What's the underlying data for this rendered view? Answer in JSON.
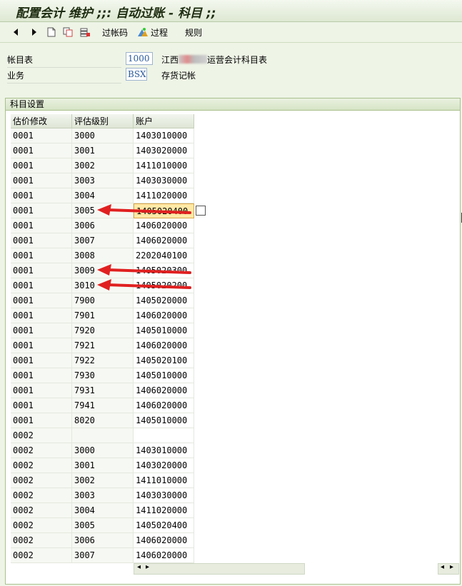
{
  "window": {
    "title": "配置会计 维护 ;;: 自动过账 - 科目 ;;"
  },
  "toolbar": {
    "back": "back-arrow-icon",
    "forward": "forward-arrow-icon",
    "posting_key_label": "过帐码",
    "procedures_label": "过程",
    "rules_label": "规则"
  },
  "header": {
    "coa_label": "帐目表",
    "coa_value": "1000",
    "coa_desc_prefix": "江西",
    "coa_desc_suffix": "运营会计科目表",
    "txn_label": "业务",
    "txn_value": "BSX",
    "txn_desc": "存货记帐"
  },
  "section": {
    "title": "科目设置",
    "columns": [
      "估价修改",
      "评估级别",
      "账户"
    ],
    "rows": [
      [
        "0001",
        "3000",
        "1403010000"
      ],
      [
        "0001",
        "3001",
        "1403020000"
      ],
      [
        "0001",
        "3002",
        "1411010000"
      ],
      [
        "0001",
        "3003",
        "1403030000"
      ],
      [
        "0001",
        "3004",
        "1411020000"
      ],
      [
        "0001",
        "3005",
        "1405020400"
      ],
      [
        "0001",
        "3006",
        "1406020000"
      ],
      [
        "0001",
        "3007",
        "1406020000"
      ],
      [
        "0001",
        "3008",
        "2202040100"
      ],
      [
        "0001",
        "3009",
        "1405020300"
      ],
      [
        "0001",
        "3010",
        "1405020200"
      ],
      [
        "0001",
        "7900",
        "1405020000"
      ],
      [
        "0001",
        "7901",
        "1406020000"
      ],
      [
        "0001",
        "7920",
        "1405010000"
      ],
      [
        "0001",
        "7921",
        "1406020000"
      ],
      [
        "0001",
        "7922",
        "1405020100"
      ],
      [
        "0001",
        "7930",
        "1405010000"
      ],
      [
        "0001",
        "7931",
        "1406020000"
      ],
      [
        "0001",
        "7941",
        "1406020000"
      ],
      [
        "0001",
        "8020",
        "1405010000"
      ],
      [
        "0002",
        "",
        ""
      ],
      [
        "0002",
        "3000",
        "1403010000"
      ],
      [
        "0002",
        "3001",
        "1403020000"
      ],
      [
        "0002",
        "3002",
        "1411010000"
      ],
      [
        "0002",
        "3003",
        "1403030000"
      ],
      [
        "0002",
        "3004",
        "1411020000"
      ],
      [
        "0002",
        "3005",
        "1405020400"
      ],
      [
        "0002",
        "3006",
        "1406020000"
      ],
      [
        "0002",
        "3007",
        "1406020000"
      ]
    ],
    "highlighted_row": 5,
    "annotated_rows": [
      5,
      9,
      10
    ],
    "arrow_color": "#e02020"
  }
}
